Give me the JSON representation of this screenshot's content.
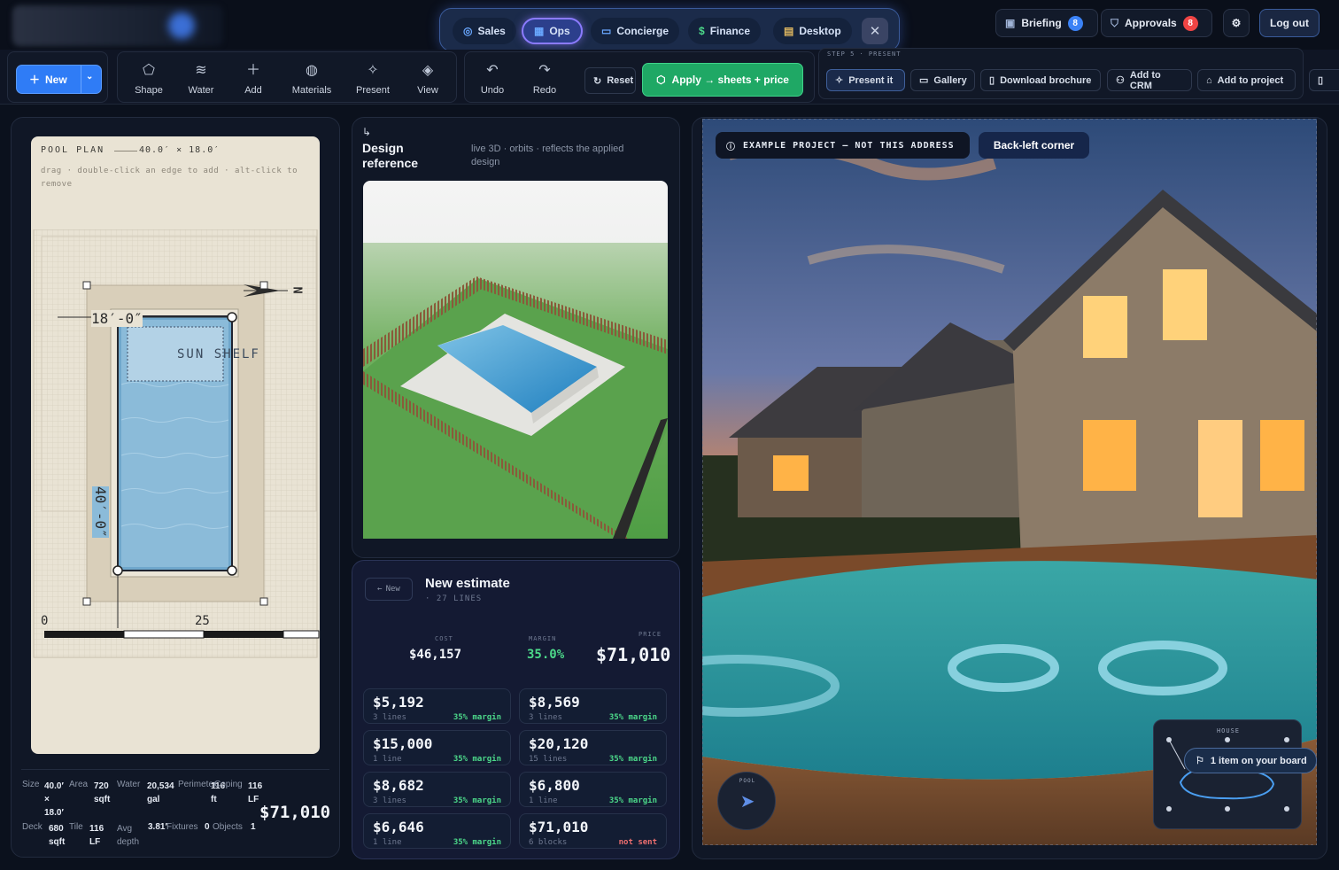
{
  "modes": [
    {
      "label": "Sales",
      "icon": "target-icon"
    },
    {
      "label": "Ops",
      "icon": "grid-icon",
      "active": true
    },
    {
      "label": "Concierge",
      "icon": "chat-icon"
    },
    {
      "label": "Finance",
      "icon": "dollar-icon"
    },
    {
      "label": "Desktop",
      "icon": "stack-icon"
    }
  ],
  "header": {
    "briefing_label": "Briefing",
    "briefing_count": "8",
    "approvals_label": "Approvals",
    "approvals_count": "8",
    "logout_label": "Log out"
  },
  "toolbar": {
    "new_label": "New",
    "tools": [
      "Shape",
      "Water",
      "Add",
      "Materials",
      "Present",
      "View"
    ],
    "undo_label": "Undo",
    "redo_label": "Redo",
    "reset_label": "Reset",
    "apply_label": "Apply → sheets + price",
    "step_label": "STEP 5 · PRESENT",
    "present_actions": [
      "Present it",
      "Gallery",
      "Download brochure",
      "Add to CRM",
      "Add to project"
    ]
  },
  "plan": {
    "title": "POOL PLAN",
    "dims": "40.0′ × 18.0′",
    "hint": "drag · double-click an edge to add · alt-click to remove",
    "shelf_label": "SUN SHELF",
    "width_label": "18′-0″",
    "length_label": "40′-0″",
    "north": "N",
    "scale_start": "0",
    "scale_mid": "25"
  },
  "stats": {
    "size_label": "Size",
    "size_val": "40.0′ × 18.0′",
    "area_label": "Area",
    "area_val": "720 sqft",
    "water_label": "Water",
    "water_val": "20,534 gal",
    "perimeter_label": "Perimeter",
    "perimeter_val": "116 ft",
    "coping_label": "Coping",
    "coping_val": "116 LF",
    "deck_label": "Deck",
    "deck_val": "680 sqft",
    "tile_label": "Tile",
    "tile_val": "116 LF",
    "depth_label": "Avg depth",
    "depth_val": "3.81′",
    "fixtures_label": "Fixtures",
    "fixtures_val": "0",
    "objects_label": "Objects",
    "objects_val": "1",
    "total": "$71,010"
  },
  "design_ref": {
    "title": "Design reference",
    "subtitle": "live 3D · orbits · reflects the applied design"
  },
  "estimate": {
    "back_label": "New",
    "title": "New estimate",
    "lines": "· 27 LINES",
    "cost_label": "COST",
    "cost": "$46,157",
    "margin_label": "MARGIN",
    "margin": "35.0%",
    "price_label": "PRICE",
    "price": "$71,010",
    "cards": [
      {
        "amt": "$5,192",
        "sub": "3 lines",
        "margin": "35% margin"
      },
      {
        "amt": "$8,569",
        "sub": "3 lines",
        "margin": "35% margin"
      },
      {
        "amt": "$15,000",
        "sub": "1 line",
        "margin": "35% margin"
      },
      {
        "amt": "$20,120",
        "sub": "15 lines",
        "margin": "35% margin"
      },
      {
        "amt": "$8,682",
        "sub": "3 lines",
        "margin": "35% margin"
      },
      {
        "amt": "$6,800",
        "sub": "1 line",
        "margin": "35% margin"
      },
      {
        "amt": "$6,646",
        "sub": "1 line",
        "margin": "35% margin"
      },
      {
        "amt": "$71,010",
        "sub": "6 blocks",
        "margin": "not sent"
      }
    ]
  },
  "photo": {
    "example_label": "EXAMPLE PROJECT — NOT THIS ADDRESS",
    "corner_label": "Back-left corner",
    "pool_label": "POOL",
    "house_label": "HOUSE",
    "board_label": "1 item on your board"
  },
  "colors": {
    "accent": "#2f7cf6",
    "green": "#1fa865",
    "badge_blue": "#3b82f6",
    "badge_red": "#ef4444"
  }
}
